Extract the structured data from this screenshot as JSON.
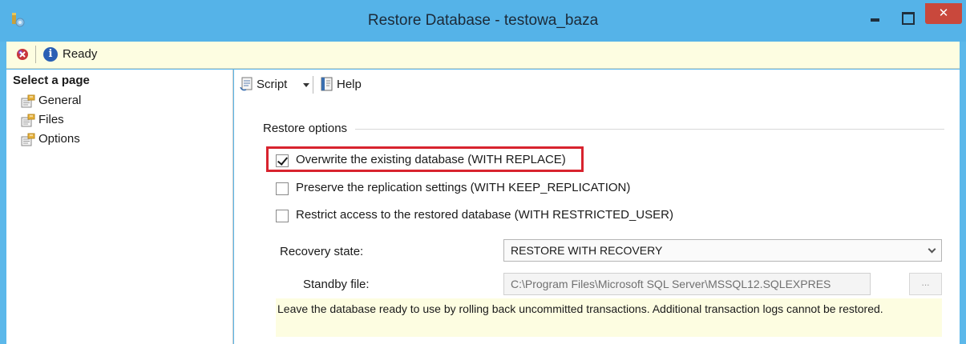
{
  "window": {
    "title": "Restore Database - testowa_baza",
    "close_symbol": "✕"
  },
  "status": {
    "text": "Ready",
    "info_glyph": "i"
  },
  "left_pane": {
    "title": "Select a page",
    "items": [
      {
        "label": "General"
      },
      {
        "label": "Files"
      },
      {
        "label": "Options"
      }
    ]
  },
  "toolbar": {
    "script_label": "Script",
    "help_label": "Help"
  },
  "restore_options": {
    "group_title": "Restore options",
    "options": [
      {
        "label": "Overwrite the existing database (WITH REPLACE)",
        "checked": true
      },
      {
        "label": "Preserve the replication settings (WITH KEEP_REPLICATION)",
        "checked": false
      },
      {
        "label": "Restrict access to the restored database (WITH RESTRICTED_USER)",
        "checked": false
      }
    ],
    "recovery_state_label": "Recovery state:",
    "recovery_state_value": "RESTORE WITH RECOVERY",
    "standby_label": "Standby file:",
    "standby_value": "C:\\Program Files\\Microsoft SQL Server\\MSSQL12.SQLEXPRES",
    "browse_label": "...",
    "info_text": "Leave the database ready to use by rolling back uncommitted transactions. Additional transaction logs cannot be restored."
  },
  "colors": {
    "title_bar": "#55b3e8",
    "close_button": "#c9483c",
    "status_bg": "#fdfde1",
    "highlight": "#d8232e"
  },
  "icons": [
    "app-icon",
    "stop-icon",
    "info-icon",
    "page-icon",
    "script-icon",
    "help-icon"
  ]
}
